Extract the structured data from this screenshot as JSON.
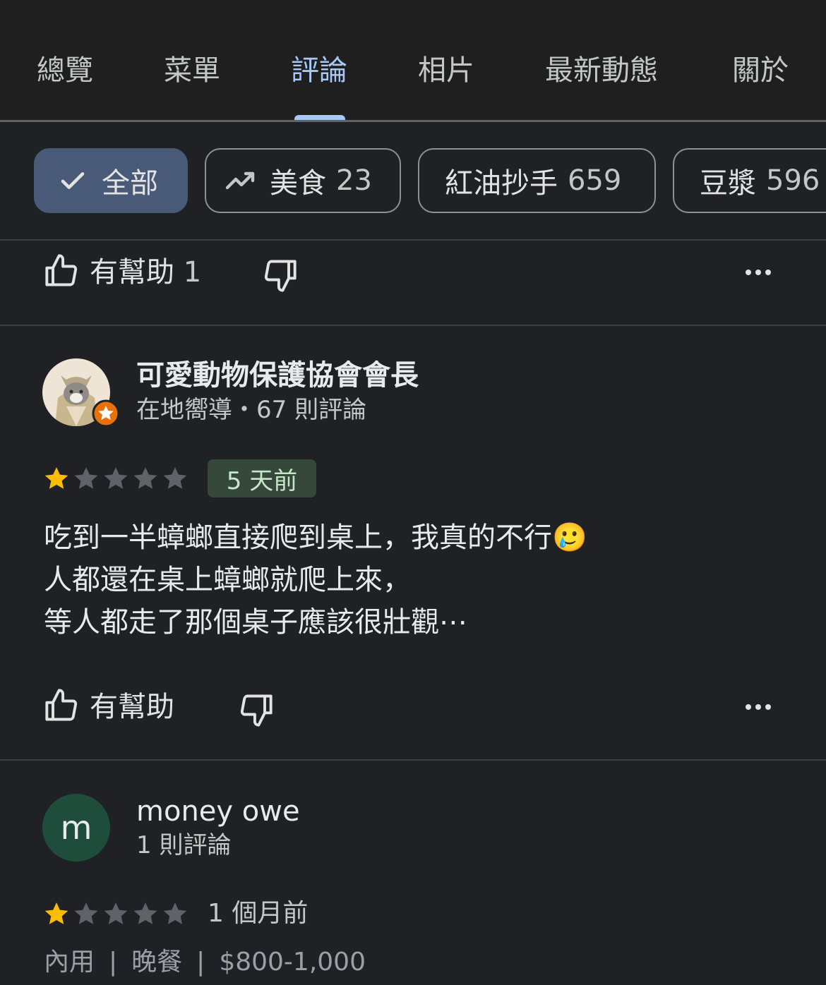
{
  "tabs": [
    {
      "label": "總覽",
      "active": false
    },
    {
      "label": "菜單",
      "active": false
    },
    {
      "label": "評論",
      "active": true
    },
    {
      "label": "相片",
      "active": false
    },
    {
      "label": "最新動態",
      "active": false
    },
    {
      "label": "關於",
      "active": false
    }
  ],
  "filters": [
    {
      "label": "全部",
      "icon": "check-icon",
      "selected": true
    },
    {
      "label": "美食",
      "count": "23",
      "icon": "trending-up-icon",
      "selected": false
    },
    {
      "label": "紅油抄手",
      "count": "659",
      "selected": false
    },
    {
      "label": "豆漿",
      "count": "596",
      "selected": false
    }
  ],
  "prev_review_actions": {
    "helpful_label": "有幫助",
    "helpful_count": "1"
  },
  "reviews": [
    {
      "author": "可愛動物保護協會會長",
      "author_meta": "在地嚮導・67 則評論",
      "rating": 1,
      "max_rating": 5,
      "date": "5 天前",
      "text_lines": [
        "吃到一半蟑螂直接爬到桌上，我真的不行",
        "人都還在桌上蟑螂就爬上來，",
        "等人都走了那個桌子應該很壯觀⋯"
      ],
      "emoji": "🥲",
      "helpful_label": "有幫助"
    },
    {
      "author": "money owe",
      "avatar_letter": "m",
      "author_meta": "1 則評論",
      "rating": 1,
      "max_rating": 5,
      "date": "1 個月前",
      "tags": [
        "內用",
        "晚餐",
        "$800-1,000"
      ],
      "tag_separator": "|"
    }
  ],
  "colors": {
    "background": "#202124",
    "accent": "#a8c7fa",
    "star_filled": "#fbbc04",
    "star_empty": "#5f6368",
    "chip_selected": "#485a78",
    "avatar_green": "#1e4d3b",
    "local_guide_badge": "#e8710a"
  }
}
